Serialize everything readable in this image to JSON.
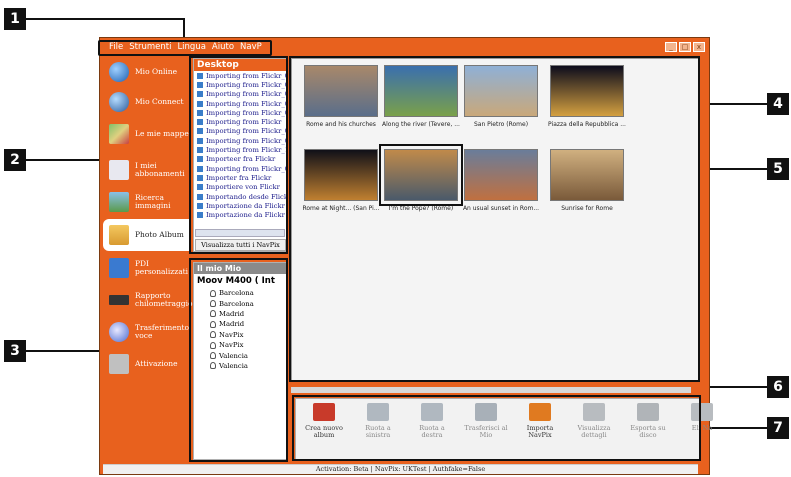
{
  "callouts": [
    "1",
    "2",
    "3",
    "4",
    "5",
    "6",
    "7"
  ],
  "menu": {
    "items": [
      "File",
      "Strumenti",
      "Lingua",
      "Aiuto",
      "NavP"
    ]
  },
  "window_controls": [
    "_",
    "□",
    "x"
  ],
  "nav": {
    "items": [
      {
        "label": "Mio Online",
        "icon": "globe-icon"
      },
      {
        "label": "Mio Connect",
        "icon": "globe-connect-icon"
      },
      {
        "label": "Le mie mappe",
        "icon": "map-icon"
      },
      {
        "label": "I miei abbonamenti",
        "icon": "mail-icon"
      },
      {
        "label": "Ricerca immagini",
        "icon": "image-search-icon"
      },
      {
        "label": "Photo Album",
        "icon": "folder-icon"
      },
      {
        "label": "PDI personalizzati",
        "icon": "poi-icon"
      },
      {
        "label": "Rapporto chilometraggio",
        "icon": "odometer-icon"
      },
      {
        "label": "Trasferimento voce",
        "icon": "voice-icon"
      },
      {
        "label": "Attivazione",
        "icon": "key-icon"
      }
    ]
  },
  "desktop": {
    "title": "Desktop",
    "items": [
      "Importing from Flickr_03",
      "Importing from Flickr_04",
      "Importing from Flickr_05",
      "Importing from Flickr_06",
      "Importing from Flickr_07",
      "Importing from Flickr",
      "Importing from Flickr_08",
      "Importing from Flickr_09",
      "Importing from Flickr_10",
      "Importeer fra Flickr",
      "Importing from Flickr_01",
      "Importer fra Flickr",
      "Importiere von Flickr",
      "Importando desde Flickr",
      "Importazione da Flickr in c",
      "Importazione da Flickr in c"
    ],
    "view_all": "Visualizza tutti i NavPix"
  },
  "mio": {
    "title": "Il mio Mio",
    "device": "Moov M400 ( Int",
    "items": [
      "Barcelona",
      "Barcelona",
      "Madrid",
      "Madrid",
      "NavPix",
      "NavPix",
      "Valencia",
      "Valencia"
    ]
  },
  "gallery": {
    "photos": [
      {
        "caption": "Rome and his churches",
        "colors": [
          "#a8886a",
          "#5a6e8a"
        ]
      },
      {
        "caption": "Along the river (Tevere, ...",
        "colors": [
          "#3a6fae",
          "#7aa04a"
        ]
      },
      {
        "caption": "San Pietro (Rome)",
        "colors": [
          "#8fb0d6",
          "#c9a87a"
        ]
      },
      {
        "caption": "Piazza della Repubblica ...",
        "colors": [
          "#0c0c1c",
          "#d4a040"
        ]
      },
      {
        "caption": "Rome at Night... (San Pi...",
        "colors": [
          "#101018",
          "#c08030"
        ]
      },
      {
        "caption": "I'm the Pope? (Rome)",
        "colors": [
          "#c08a4a",
          "#4a5a6a"
        ]
      },
      {
        "caption": "An usual sunset in Rom...",
        "colors": [
          "#6a7d9a",
          "#c07040"
        ]
      },
      {
        "caption": "Sunrise for Rome",
        "colors": [
          "#d0b080",
          "#7a5a3a"
        ]
      }
    ]
  },
  "toolbar": {
    "buttons": [
      {
        "label": "Crea nuovo album",
        "icon": "new-album-icon",
        "enabled": true,
        "color": "#c83a2a"
      },
      {
        "label": "Ruota a sinistra",
        "icon": "rotate-left-icon",
        "enabled": false,
        "color": "#b0b8c0"
      },
      {
        "label": "Ruota a destra",
        "icon": "rotate-right-icon",
        "enabled": false,
        "color": "#b0b8c0"
      },
      {
        "label": "Trasferisci al Mio",
        "icon": "transfer-icon",
        "enabled": false,
        "color": "#a8b0b8"
      },
      {
        "label": "Importa NavPix",
        "icon": "import-icon",
        "enabled": true,
        "color": "#e07a20"
      },
      {
        "label": "Visualizza dettagli",
        "icon": "details-icon",
        "enabled": false,
        "color": "#b8bcc0"
      },
      {
        "label": "Esporta su disco",
        "icon": "export-icon",
        "enabled": false,
        "color": "#b0b4b8"
      },
      {
        "label": "Eli Na",
        "icon": "delete-icon",
        "enabled": false,
        "color": "#b8bcc0"
      }
    ]
  },
  "status": {
    "text": "Activation: Beta  |  NavPix: UKTest  |  Authfake=False"
  },
  "colors": {
    "brand": "#e8611e",
    "frame": "#7a3a10"
  }
}
